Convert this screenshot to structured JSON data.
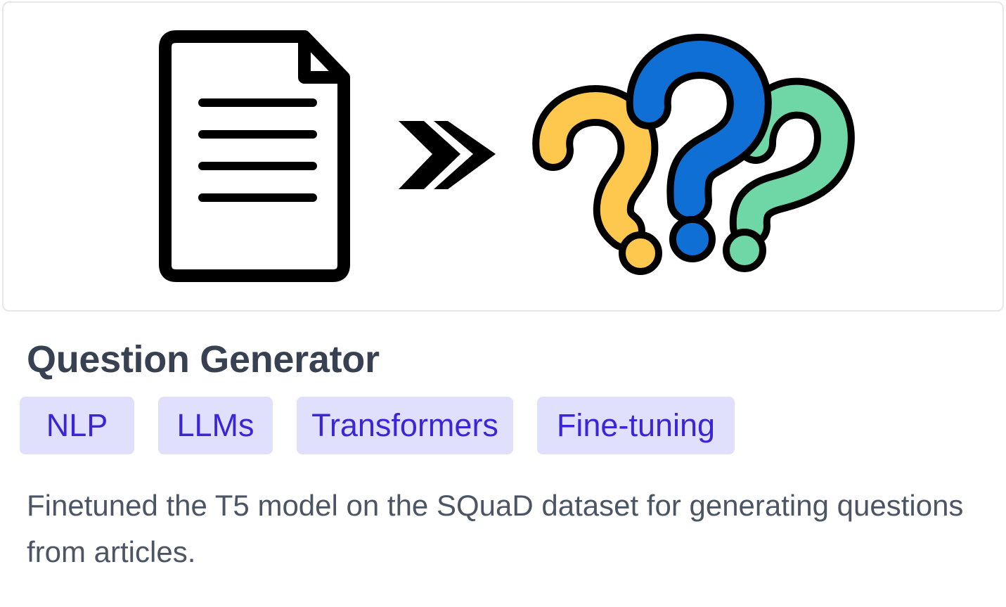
{
  "project": {
    "title": "Question Generator",
    "tags": [
      "NLP",
      "LLMs",
      "Transformers",
      "Fine-tuning"
    ],
    "description": "Finetuned the T5 model on the SQuaD dataset for generating questions from articles."
  },
  "hero": {
    "icons": [
      "document-icon",
      "double-chevron-right-icon",
      "question-marks-icon"
    ]
  },
  "colors": {
    "title": "#374151",
    "tag_background": "#e0e0fc",
    "tag_text": "#3b25d9",
    "description": "#4b5563",
    "border": "#e5e7eb",
    "question_yellow": "#fec84e",
    "question_blue": "#0f6fd4",
    "question_green": "#6ed7a5"
  }
}
